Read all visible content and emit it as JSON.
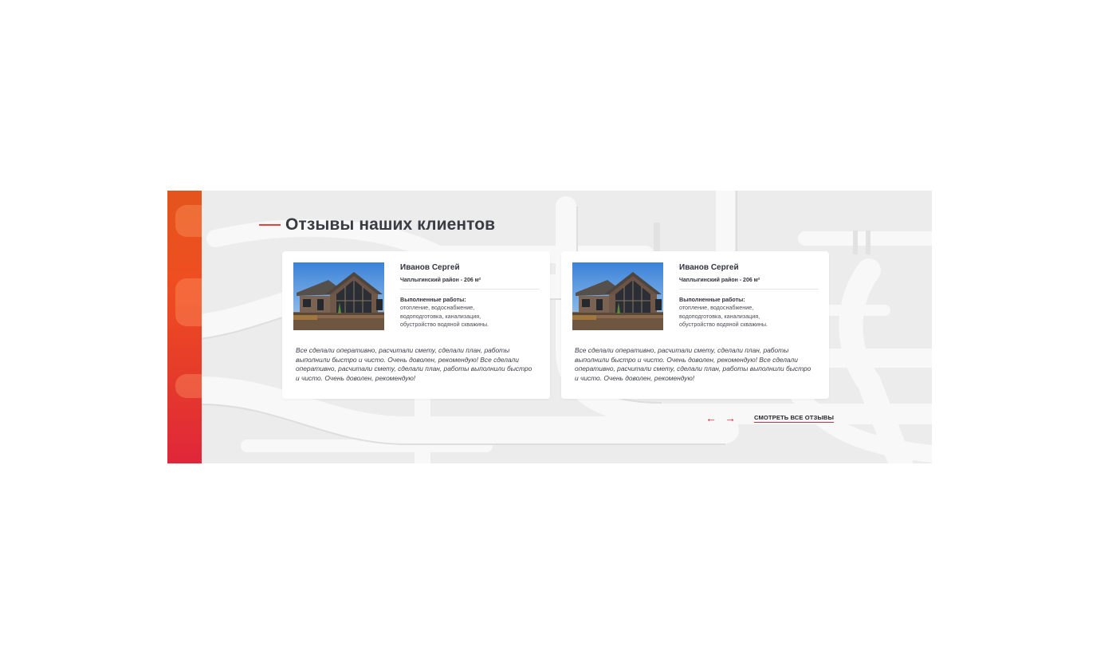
{
  "section": {
    "title": "Отзывы наших клиентов",
    "accent_color": "#e8423a"
  },
  "reviews": [
    {
      "name": "Иванов Сергей",
      "area": "Чаплыгинский район - 206 м²",
      "works_label": "Выполненные работы:",
      "works_text": "отопление, водоснабжение, водоподготовка, канализация, обустройство водяной скважины.",
      "quote": "Все сделали оперативно, расчитали смету, сделали план, работы выполнили быстро и чисто. Очень доволен, рекомендую! Все сделали оперативно, расчитали смету, сделали план, работы выполнили быстро и чисто. Очень доволен, рекомендую!"
    },
    {
      "name": "Иванов Сергей",
      "area": "Чаплыгинский район - 206 м²",
      "works_label": "Выполненные работы:",
      "works_text": "отопление, водоснабжение, водоподготовка, канализация, обустройство водяной скважины.",
      "quote": "Все сделали оперативно, расчитали смету, сделали план, работы выполнили быстро и чисто. Очень доволен, рекомендую! Все сделали оперативно, расчитали смету, сделали план, работы выполнили быстро и чисто. Очень доволен, рекомендую!"
    }
  ],
  "navigation": {
    "prev_icon": "arrow-left-icon",
    "next_icon": "arrow-right-icon",
    "prev_glyph": "←",
    "next_glyph": "→",
    "all_reviews_label": "СМОТРЕТЬ ВСЕ ОТЗЫВЫ"
  }
}
